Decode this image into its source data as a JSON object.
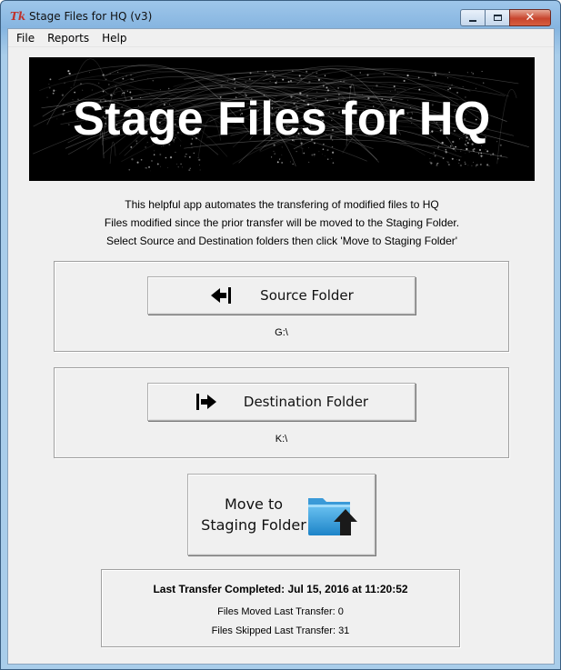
{
  "window": {
    "title": "Stage Files for HQ (v3)",
    "icon": "tk-feather-icon",
    "caption_buttons": [
      "minimize",
      "maximize",
      "close"
    ],
    "close_symbol": "✕"
  },
  "menu": [
    {
      "label": "File"
    },
    {
      "label": "Reports"
    },
    {
      "label": "Help"
    }
  ],
  "banner": {
    "title": "Stage Files for HQ"
  },
  "intro": [
    "This helpful app automates the transfering of modified files to HQ",
    "Files modified since the prior transfer will be moved to the Staging Folder.",
    "Select Source and Destination folders then click 'Move to Staging Folder'"
  ],
  "source": {
    "button_label": "Source Folder",
    "icon": "arrow-left-icon",
    "path": "G:\\"
  },
  "destination": {
    "button_label": "Destination Folder",
    "icon": "arrow-right-icon",
    "path": "K:\\"
  },
  "move": {
    "label_line1": "Move to",
    "label_line2": "Staging Folder",
    "icon": "folder-upload-icon"
  },
  "status": {
    "last_transfer": "Last Transfer Completed: Jul 15, 2016 at 11:20:52",
    "files_moved": "Files Moved Last Transfer:  0",
    "files_skipped": "Files Skipped Last Transfer: 31"
  },
  "colors": {
    "client_bg": "#f0f0f0",
    "banner_bg": "#000000",
    "banner_text": "#ffffff",
    "folder_icon": "#3aa0de"
  }
}
